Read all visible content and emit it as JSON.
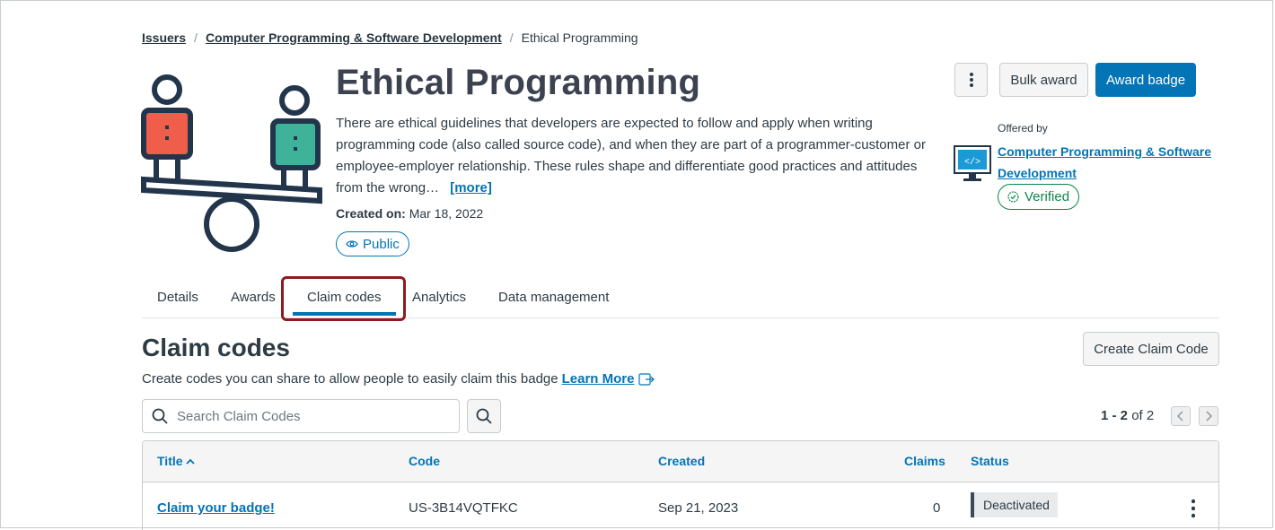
{
  "breadcrumb": {
    "items": [
      "Issuers",
      "Computer Programming & Software Development"
    ],
    "current": "Ethical Programming",
    "separator": "/"
  },
  "badge": {
    "title": "Ethical Programming",
    "description": "There are ethical guidelines that developers are expected to follow and apply when writing programming code (also called source code), and when they are part of a programmer-customer or employee-employer relationship. These rules shape and differentiate good practices and attitudes from the wrong…",
    "more_label": "[more]",
    "created_label": "Created on:",
    "created_value": "Mar 18, 2022",
    "visibility": "Public"
  },
  "actions": {
    "kebab_icon": "more-vertical-icon",
    "bulk_award": "Bulk award",
    "award_badge": "Award badge"
  },
  "issuer": {
    "offered_by_label": "Offered by",
    "name": "Computer Programming & Software Development",
    "status": "Verified"
  },
  "tabs": [
    {
      "label": "Details",
      "active": false
    },
    {
      "label": "Awards",
      "active": false
    },
    {
      "label": "Claim codes",
      "active": true
    },
    {
      "label": "Analytics",
      "active": false
    },
    {
      "label": "Data management",
      "active": false
    }
  ],
  "claim_codes": {
    "heading": "Claim codes",
    "create_button": "Create Claim Code",
    "helper_text": "Create codes you can share to allow people to easily claim this badge",
    "learn_more": "Learn More",
    "search_placeholder": "Search Claim Codes",
    "pager": {
      "range": "1 - 2",
      "of_label": "of",
      "total": "2"
    },
    "columns": {
      "title": "Title",
      "code": "Code",
      "created": "Created",
      "claims": "Claims",
      "status": "Status"
    },
    "rows": [
      {
        "title": "Claim your badge!",
        "code": "US-3B14VQTFKC",
        "created": "Sep 21, 2023",
        "claims": "0",
        "status": "Deactivated"
      }
    ]
  },
  "colors": {
    "accent": "#0374b5",
    "verified": "#0b874b",
    "highlight": "#8e1b1f",
    "figure_left": "#ef5e4b",
    "figure_right": "#3fb39a",
    "figure_stroke": "#22354a"
  }
}
